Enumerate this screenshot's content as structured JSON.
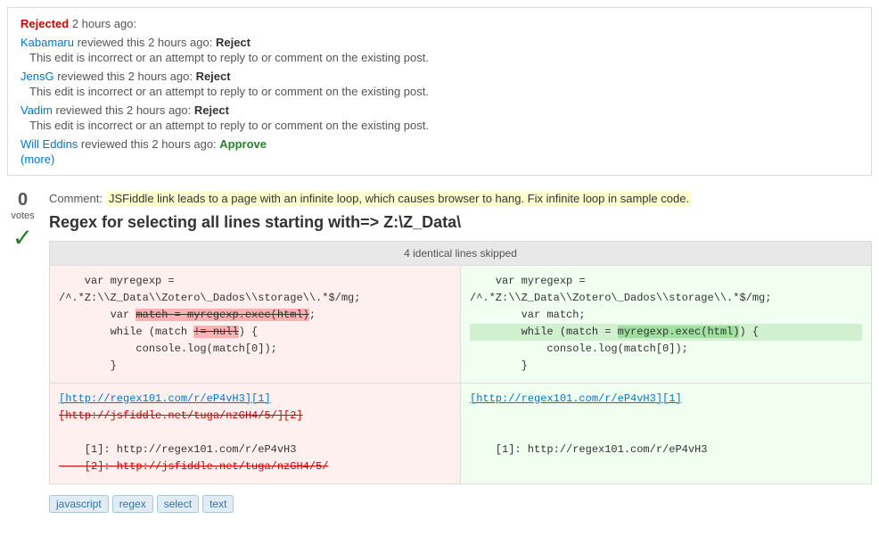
{
  "rejection": {
    "header": "Rejected",
    "header_time": " 2 hours ago:",
    "reviewers": [
      {
        "name": "Kabamaru",
        "time": " reviewed this 2 hours ago: ",
        "action": "Reject",
        "reason": "This edit is incorrect or an attempt to reply to or comment on the existing post."
      },
      {
        "name": "JensG",
        "time": " reviewed this 2 hours ago: ",
        "action": "Reject",
        "reason": "This edit is incorrect or an attempt to reply to or comment on the existing post."
      },
      {
        "name": "Vadim",
        "time": " reviewed this 2 hours ago: ",
        "action": "Reject",
        "reason": "This edit is incorrect or an attempt to reply to or comment on the existing post."
      },
      {
        "name": "Will Eddins",
        "time": " reviewed this 2 hours ago: ",
        "action": "Approve",
        "reason": ""
      }
    ],
    "more_link": "(more)"
  },
  "comment": {
    "label": "Comment:",
    "text": "JSFiddle link leads to a page with an infinite loop, which causes browser to hang. Fix infinite loop in sample code."
  },
  "question": {
    "title": "Regex for selecting all lines starting with=> Z:\\Z_Data\\"
  },
  "diff": {
    "skipped_label": "4 identical lines skipped",
    "left_code": [
      "    var myregexp =",
      "/^.*Z:\\\\Z_Data\\\\Zotero\\\\_Dados\\\\storage\\\\.*$/mg;",
      "        var match = myregexp.exec(html);",
      "        while (match != null) {",
      "            console.log(match[0]);",
      "        }"
    ],
    "right_code": [
      "    var myregexp =",
      "/^.*Z:\\\\Z_Data\\\\Zotero\\\\_Dados\\\\storage\\\\.*$/mg;",
      "        var match;",
      "        while (match = myregexp.exec(html)) {",
      "            console.log(match[0]);",
      "        }"
    ],
    "left_links": [
      "[http://regex101.com/r/eP4vH3][1]",
      "[http://jsfiddle.net/tuga/nzGH4/5/][2]"
    ],
    "right_links": [
      "[http://regex101.com/r/eP4vH3][1]"
    ],
    "left_footnotes": [
      "    [1]: http://regex101.com/r/eP4vH3",
      "    [2]: http://jsfiddle.net/tuga/nzGH4/5/"
    ],
    "right_footnotes": [
      "    [1]: http://regex101.com/r/eP4vH3"
    ]
  },
  "tags": [
    "javascript",
    "regex",
    "select",
    "text"
  ]
}
